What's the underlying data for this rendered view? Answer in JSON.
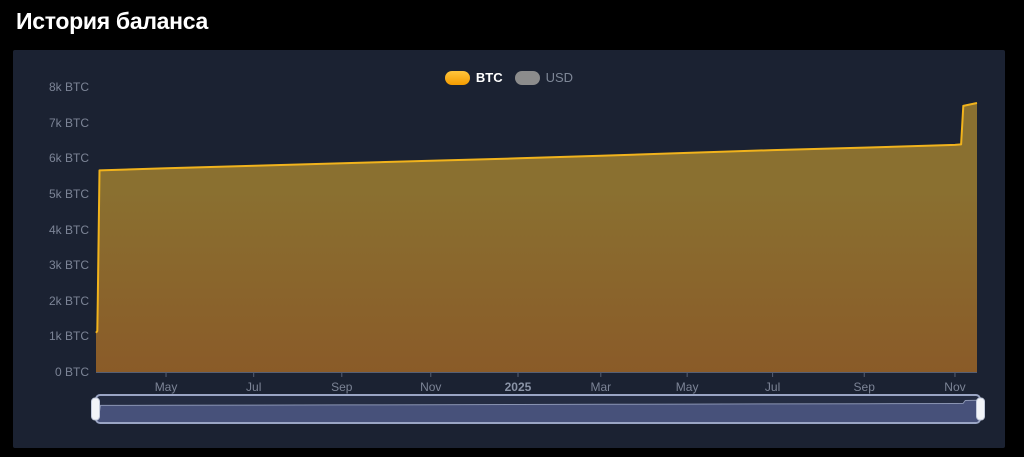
{
  "header": {
    "title": "История баланса"
  },
  "chart": {
    "panel_bg": "#1B2232",
    "accent": "#F7A600",
    "axis_label_color": "#7C8496",
    "year_label_color": "#8A93A6",
    "axis_line_color": "#565F73",
    "legend": [
      {
        "label": "BTC",
        "active": true,
        "swatch_gradient": [
          "#FFC53D",
          "#F49B00"
        ],
        "label_color": "#FFFFFF"
      },
      {
        "label": "USD",
        "active": false,
        "swatch_color": "#8C8C8C",
        "label_color": "#7E8797"
      }
    ]
  },
  "chart_data": {
    "type": "area",
    "title": "История баланса",
    "xlabel": "",
    "ylabel": "BTC",
    "ylim": [
      0,
      8000
    ],
    "grid": false,
    "legend_position": "top-center",
    "y_ticks": [
      {
        "label": "0 BTC",
        "value": 0
      },
      {
        "label": "1k BTC",
        "value": 1000
      },
      {
        "label": "2k BTC",
        "value": 2000
      },
      {
        "label": "3k BTC",
        "value": 3000
      },
      {
        "label": "4k BTC",
        "value": 4000
      },
      {
        "label": "5k BTC",
        "value": 5000
      },
      {
        "label": "6k BTC",
        "value": 6000
      },
      {
        "label": "7k BTC",
        "value": 7000
      },
      {
        "label": "8k BTC",
        "value": 8000
      }
    ],
    "x_ticks": [
      {
        "label": "May",
        "f": 0.0795
      },
      {
        "label": "Jul",
        "f": 0.179
      },
      {
        "label": "Sep",
        "f": 0.279
      },
      {
        "label": "Nov",
        "f": 0.38
      },
      {
        "label": "2025",
        "f": 0.479,
        "emphasis": true
      },
      {
        "label": "Mar",
        "f": 0.573
      },
      {
        "label": "May",
        "f": 0.671
      },
      {
        "label": "Jul",
        "f": 0.768
      },
      {
        "label": "Sep",
        "f": 0.872
      },
      {
        "label": "Nov",
        "f": 0.975
      }
    ],
    "series": [
      {
        "name": "BTC",
        "visible": true,
        "line_color": "#F1B31C",
        "area_top": "#8A7030",
        "area_bottom": "#8A5A28",
        "points": [
          [
            0.0,
            1100
          ],
          [
            0.0015,
            1150
          ],
          [
            0.002,
            2050
          ],
          [
            0.004,
            5660
          ],
          [
            0.08,
            5720
          ],
          [
            0.18,
            5790
          ],
          [
            0.28,
            5860
          ],
          [
            0.38,
            5930
          ],
          [
            0.48,
            6000
          ],
          [
            0.573,
            6070
          ],
          [
            0.671,
            6150
          ],
          [
            0.768,
            6230
          ],
          [
            0.872,
            6300
          ],
          [
            0.975,
            6375
          ],
          [
            0.982,
            6390
          ],
          [
            0.9845,
            7470
          ],
          [
            1.0,
            7550
          ]
        ]
      },
      {
        "name": "USD",
        "visible": false,
        "points": []
      }
    ]
  },
  "slider": {
    "track_bg": "#242C42",
    "fill_color": "#47517A",
    "border_color": "#9AA5C4",
    "preview_line_color": "#8A94B2",
    "handle_color": "#F2F4F8",
    "range_percent": [
      0,
      100
    ]
  }
}
